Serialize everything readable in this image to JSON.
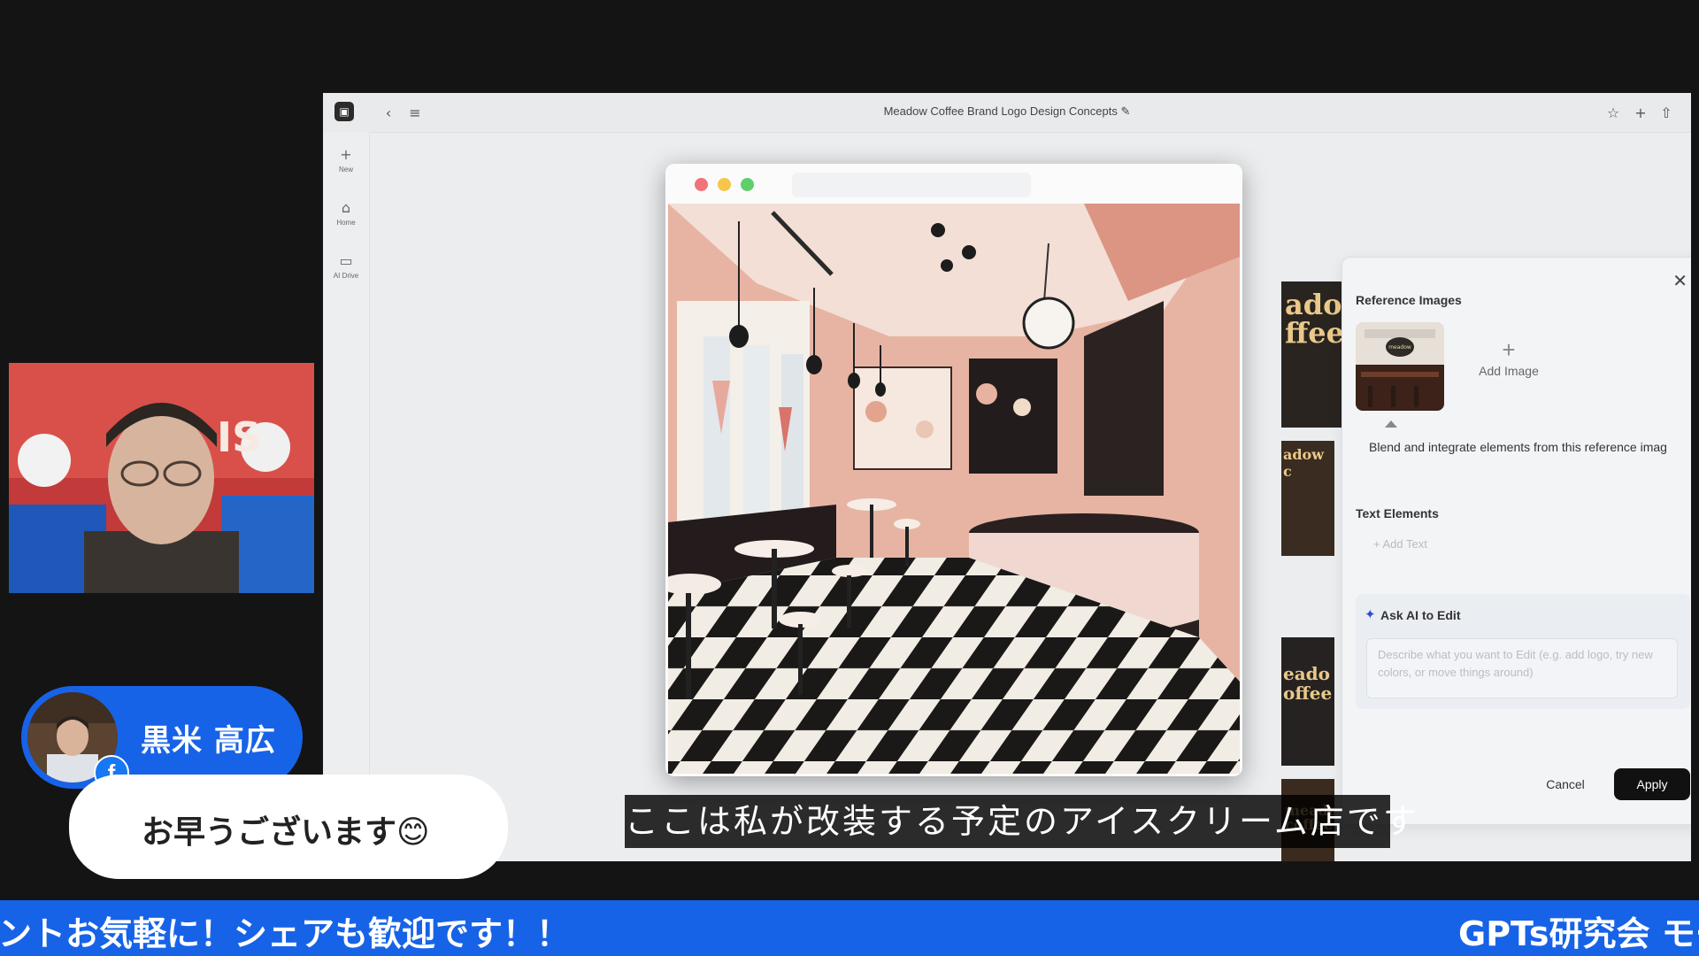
{
  "app": {
    "title": "Meadow Coffee Brand Logo Design Concepts",
    "rail": [
      {
        "label": "New",
        "icon": "plus-icon"
      },
      {
        "label": "Home",
        "icon": "home-icon"
      },
      {
        "label": "AI Drive",
        "icon": "folder-icon"
      }
    ]
  },
  "edit_panel": {
    "reference_heading": "Reference Images",
    "add_image_label": "Add Image",
    "reference_description": "Blend and integrate elements from this reference imag",
    "text_elements_heading": "Text Elements",
    "add_text_label": "Add Text",
    "ask_ai_title": "Ask AI to Edit",
    "ask_ai_placeholder": "Describe what you want to Edit (e.g. add logo, try new colors, or move things around)",
    "cancel_label": "Cancel",
    "apply_label": "Apply"
  },
  "stream": {
    "commenter_name": "黒米 高広",
    "comment_text": "お早うございます😊",
    "subtitle": "ここは私が改装する予定のアイスクリーム店です",
    "ticker_left": "ントお気軽に！シェアも歓迎です！！",
    "ticker_right": "GPTs研究会 モー"
  },
  "colors": {
    "ticker_bg": "#1763e8",
    "apply_bg": "#111111",
    "traffic_red": "#f0727a",
    "traffic_yellow": "#f5c64a",
    "traffic_green": "#5ecf6a"
  }
}
